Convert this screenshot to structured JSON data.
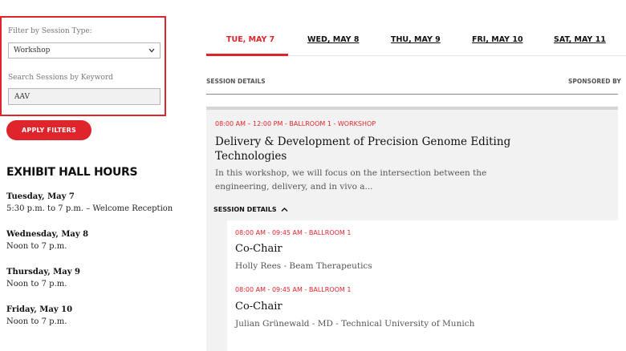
{
  "filters": {
    "session_type_label": "Filter by Session Type:",
    "session_type_value": "Workshop",
    "keyword_label": "Search Sessions by Keyword",
    "keyword_value": "AAV",
    "apply_label": "APPLY FILTERS"
  },
  "exhibit_hours": {
    "title": "EXHIBIT HALL HOURS",
    "days": [
      {
        "day": "Tuesday, May 7",
        "time": "5:30 p.m. to 7 p.m. – Welcome Reception"
      },
      {
        "day": "Wednesday, May 8",
        "time": "Noon to 7 p.m."
      },
      {
        "day": "Thursday, May 9",
        "time": "Noon to 7 p.m."
      },
      {
        "day": "Friday, May 10",
        "time": "Noon to 7 p.m."
      }
    ]
  },
  "tabs": [
    {
      "label": "TUE, MAY 7",
      "active": true
    },
    {
      "label": "WED, MAY 8",
      "active": false
    },
    {
      "label": "THU, MAY 9",
      "active": false
    },
    {
      "label": "FRI, MAY 10",
      "active": false
    },
    {
      "label": "SAT, MAY 11",
      "active": false
    }
  ],
  "columns": {
    "left": "SESSION DETAILS",
    "right": "SPONSORED BY"
  },
  "session": {
    "meta": "08:00 AM – 12:00 PM - BALLROOM 1 - WORKSHOP",
    "title": "Delivery & Development of Precision Genome Editing Technologies",
    "description": "In this workshop, we will focus on the intersection between the engineering, delivery, and in vivo a...",
    "details_toggle": "SESSION DETAILS",
    "subsessions": [
      {
        "meta": "08:00 AM - 09:45 AM - BALLROOM 1",
        "title": "Co-Chair",
        "person": "Holly Rees - Beam Therapeutics"
      },
      {
        "meta": "08:00 AM - 09:45 AM - BALLROOM 1",
        "title": "Co-Chair",
        "person": "Julian Grünewald - MD - Technical University of Munich"
      }
    ]
  },
  "colors": {
    "accent": "#e0242b",
    "card_background": "#f2f2f2"
  },
  "icons": {
    "select_chevron": "chevron-down-icon",
    "details_chevron": "chevron-up-icon"
  }
}
